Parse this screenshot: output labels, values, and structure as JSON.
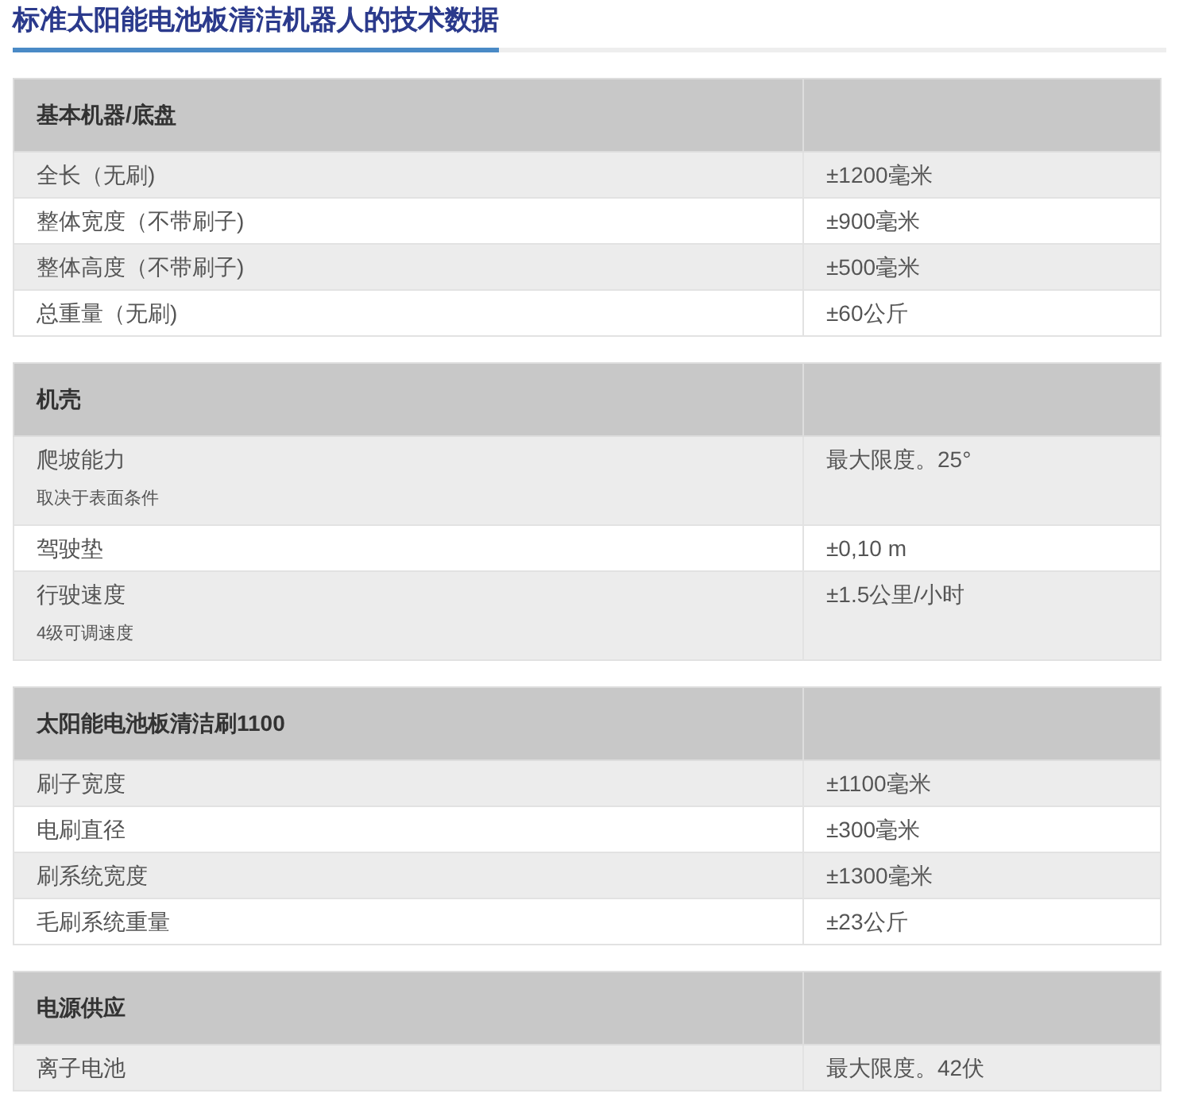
{
  "title": "标准太阳能电池板清洁机器人的技术数据",
  "sections": [
    {
      "heading": "基本机器/底盘",
      "rows": [
        {
          "label": "全长（无刷)",
          "value": "±1200毫米"
        },
        {
          "label": "整体宽度（不带刷子)",
          "value": "±900毫米"
        },
        {
          "label": "整体高度（不带刷子)",
          "value": "±500毫米"
        },
        {
          "label": "总重量（无刷)",
          "value": "±60公斤"
        }
      ]
    },
    {
      "heading": "机壳",
      "rows": [
        {
          "label": "爬坡能力",
          "note": "取决于表面条件",
          "value": "最大限度。25°"
        },
        {
          "label": "驾驶垫",
          "value": "±0,10 m"
        },
        {
          "label": "行驶速度",
          "note": "4级可调速度",
          "value": "±1.5公里/小时"
        }
      ]
    },
    {
      "heading": "太阳能电池板清洁刷1100",
      "rows": [
        {
          "label": "刷子宽度",
          "value": "±1100毫米"
        },
        {
          "label": "电刷直径",
          "value": "±300毫米"
        },
        {
          "label": "刷系统宽度",
          "value": "±1300毫米"
        },
        {
          "label": "毛刷系统重量",
          "value": "±23公斤"
        }
      ]
    },
    {
      "heading": "电源供应",
      "rows": [
        {
          "label": "离子电池",
          "value": "最大限度。42伏"
        }
      ]
    }
  ]
}
